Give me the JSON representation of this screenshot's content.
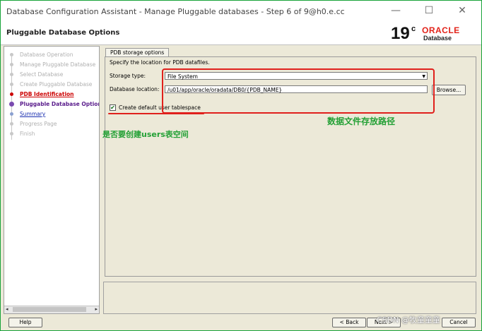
{
  "window": {
    "title": "Database Configuration Assistant - Manage Pluggable databases - Step 6 of 9@h0.e.cc",
    "minimize_icon": "minimize-icon",
    "maximize_icon": "maximize-icon",
    "close_icon": "close-icon"
  },
  "header": {
    "page_title": "Pluggable Database Options",
    "logo_version": "19",
    "logo_sup": "c",
    "logo_brand": "ORACLE",
    "logo_product": "Database"
  },
  "nav": {
    "steps": [
      {
        "label": "Database Operation",
        "state": "disabled"
      },
      {
        "label": "Manage Pluggable Database",
        "state": "disabled"
      },
      {
        "label": "Select Database",
        "state": "disabled"
      },
      {
        "label": "Create Pluggable Database",
        "state": "disabled"
      },
      {
        "label": "PDB Identification",
        "state": "error"
      },
      {
        "label": "Pluggable Database Options",
        "state": "current"
      },
      {
        "label": "Summary",
        "state": "link"
      },
      {
        "label": "Progress Page",
        "state": "disabled"
      },
      {
        "label": "Finish",
        "state": "disabled"
      }
    ],
    "scroll_left": "◂",
    "scroll_right": "▸"
  },
  "content": {
    "tab_label": "PDB storage options",
    "description": "Specify the location for PDB datafiles.",
    "storage_type_label": "Storage type:",
    "storage_type_value": "File System",
    "db_location_label": "Database location:",
    "db_location_value": "/u01/app/oracle/oradata/DB0/{PDB_NAME}",
    "browse_label": "Browse...",
    "checkbox_checked": true,
    "checkbox_mark": "✔",
    "checkbox_label": "Create default user tablespace",
    "annotation_location": "数据文件存放路径",
    "annotation_tablespace": "是否要创建users表空间"
  },
  "buttons": {
    "help": "Help",
    "back": "< Back",
    "next": "Next >",
    "cancel": "Cancel"
  },
  "watermark": "CSDN @牧童童童",
  "colors": {
    "annotation_red": "#e0201c",
    "annotation_green": "#23a035",
    "oracle_red": "#e2231a"
  }
}
